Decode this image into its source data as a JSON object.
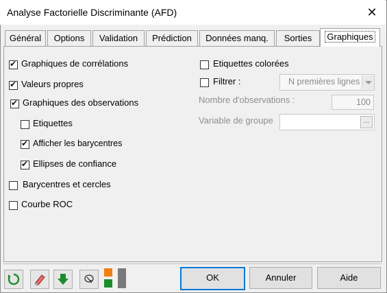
{
  "window": {
    "title": "Analyse Factorielle Discriminante (AFD)"
  },
  "tabs": [
    {
      "label": "Général"
    },
    {
      "label": "Options"
    },
    {
      "label": "Validation"
    },
    {
      "label": "Prédiction"
    },
    {
      "label": "Données manq."
    },
    {
      "label": "Sorties"
    },
    {
      "label": "Graphiques",
      "active": true
    }
  ],
  "left_options": {
    "correlations": {
      "label": "Graphiques de corrélations",
      "checked": true
    },
    "eigenvalues": {
      "label": "Valeurs propres",
      "checked": true
    },
    "observations": {
      "label": "Graphiques des observations",
      "checked": true
    },
    "labels": {
      "label": "Etiquettes",
      "checked": false
    },
    "barycenters": {
      "label": "Afficher les barycentres",
      "checked": true
    },
    "ellipses": {
      "label": "Ellipses de confiance",
      "checked": true
    },
    "barycenters_circles": {
      "label": "Barycentres et cercles",
      "checked": false
    },
    "roc": {
      "label": "Courbe ROC",
      "checked": false
    }
  },
  "right_options": {
    "colored_labels": {
      "label": "Etiquettes colorées",
      "checked": false
    },
    "filter": {
      "label": "Filtrer :",
      "checked": false,
      "select_value": "N premières lignes"
    },
    "num_obs": {
      "label": "Nombre d'observations :",
      "value": "100"
    },
    "group_var": {
      "label": "Variable de groupe",
      "value": "",
      "button": "..."
    }
  },
  "footer": {
    "ok": "OK",
    "cancel": "Annuler",
    "help": "Aide"
  },
  "icons": [
    "reset-icon",
    "eraser-icon",
    "download-arrow-icon",
    "cursor-select-icon",
    "layout-color-icon"
  ],
  "colors": {
    "accent": "#0078d7",
    "green": "#1b8c2a",
    "orange": "#f07e12"
  }
}
